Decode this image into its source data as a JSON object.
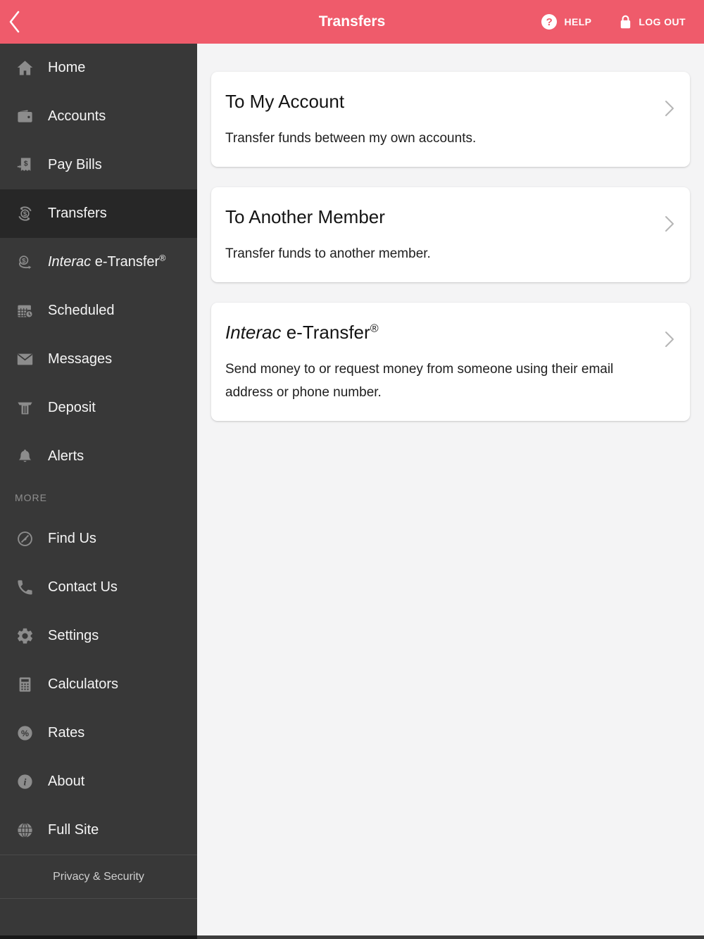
{
  "colors": {
    "header_bg": "#ef5b6b",
    "sidebar_bg": "#383838",
    "sidebar_selected_bg": "#272727",
    "content_bg": "#f4f4f5",
    "card_bg": "#ffffff",
    "icon_gray": "#8c8c8c",
    "divider": "#4a4a4a"
  },
  "header": {
    "title": "Transfers",
    "back_icon": "chevron-left-icon",
    "help": {
      "label": "HELP",
      "icon": "question-circle-icon",
      "icon_glyph": "?"
    },
    "logout": {
      "label": "LOG OUT",
      "icon": "lock-icon"
    }
  },
  "sidebar": {
    "items": [
      {
        "label": "Home",
        "icon": "home-icon",
        "selected": false
      },
      {
        "label": "Accounts",
        "icon": "wallet-icon",
        "selected": false
      },
      {
        "label": "Pay Bills",
        "icon": "bill-icon",
        "selected": false
      },
      {
        "label": "Transfers",
        "icon": "transfer-icon",
        "selected": true
      },
      {
        "label_italic": "Interac",
        "label_rest": " e-Transfer",
        "label_sup": "®",
        "icon": "etransfer-icon",
        "selected": false
      },
      {
        "label": "Scheduled",
        "icon": "calendar-clock-icon",
        "selected": false
      },
      {
        "label": "Messages",
        "icon": "envelope-icon",
        "selected": false
      },
      {
        "label": "Deposit",
        "icon": "cheque-deposit-icon",
        "selected": false
      },
      {
        "label": "Alerts",
        "icon": "bell-icon",
        "selected": false
      },
      {
        "label": "Find Us",
        "icon": "compass-icon",
        "selected": false
      },
      {
        "label": "Contact Us",
        "icon": "phone-icon",
        "selected": false
      },
      {
        "label": "Settings",
        "icon": "gear-icon",
        "selected": false
      },
      {
        "label": "Calculators",
        "icon": "calculator-icon",
        "selected": false
      },
      {
        "label": "Rates",
        "icon": "percent-circle-icon",
        "selected": false
      },
      {
        "label": "About",
        "icon": "info-circle-icon",
        "selected": false
      },
      {
        "label": "Full Site",
        "icon": "globe-icon",
        "selected": false
      }
    ],
    "section_label": "MORE",
    "footer_link": "Privacy & Security"
  },
  "main": {
    "cards": [
      {
        "title": "To My Account",
        "description": "Transfer funds between my own accounts.",
        "chevron": "chevron-right-icon"
      },
      {
        "title": "To Another Member",
        "description": "Transfer funds to another member.",
        "chevron": "chevron-right-icon"
      },
      {
        "title_italic": "Interac",
        "title_rest": " e-Transfer",
        "title_sup": "®",
        "description": "Send money to or request money from someone using their email address or phone number.",
        "chevron": "chevron-right-icon"
      }
    ]
  }
}
